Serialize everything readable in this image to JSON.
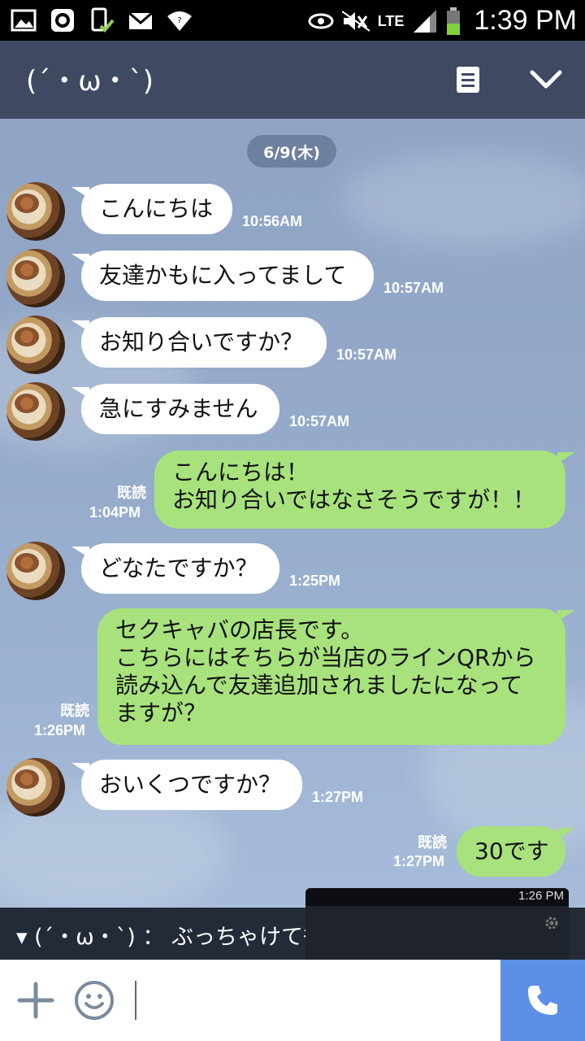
{
  "status_bar": {
    "time": "1:39 PM",
    "network": "LTE",
    "icons": [
      "gallery-icon",
      "line-app-icon",
      "clipboard-check-icon",
      "mail-icon",
      "wifi-icon",
      "eye-icon",
      "mute-icon",
      "signal-icon",
      "battery-icon"
    ]
  },
  "header": {
    "title": "(´・ω・`)",
    "icons": [
      "notes-icon",
      "chevron-down-icon"
    ]
  },
  "chat": {
    "date": "6/9(木)",
    "messages": [
      {
        "side": "in",
        "text": "こんにちは",
        "time": "10:56AM"
      },
      {
        "side": "in",
        "text": "友達かもに入ってまして",
        "time": "10:57AM"
      },
      {
        "side": "in",
        "text": "お知り合いですか？",
        "time": "10:57AM"
      },
      {
        "side": "in",
        "text": "急にすみません",
        "time": "10:57AM"
      },
      {
        "side": "out",
        "lines": [
          "こんにちは！",
          "お知り合いではなさそうですが！！"
        ],
        "read": "既読",
        "time": "1:04PM"
      },
      {
        "side": "in",
        "text": "どなたですか？",
        "time": "1:25PM"
      },
      {
        "side": "out",
        "lines": [
          "セクキャバの店長です。",
          "こちらにはそちらが当店のラインQRから",
          "読み込んで友達追加されましたになって",
          "ますが？"
        ],
        "read": "既読",
        "time": "1:26PM"
      },
      {
        "side": "in",
        "text": "おいくつですか？",
        "time": "1:27PM"
      },
      {
        "side": "out",
        "text": "30です",
        "read": "既読",
        "time": "1:27PM"
      }
    ]
  },
  "notification": {
    "text": "▾ (´・ω・`) ： ぶっちゃけても大丈夫ですか。",
    "preview_time": "1:26 PM"
  },
  "input_bar": {
    "icons": [
      "plus-icon",
      "emoji-icon",
      "phone-icon"
    ],
    "accent": "#5b8fe8"
  },
  "colors": {
    "header": "#3f4a62",
    "incoming_bubble": "#ffffff",
    "outgoing_bubble": "#a8e27c"
  }
}
